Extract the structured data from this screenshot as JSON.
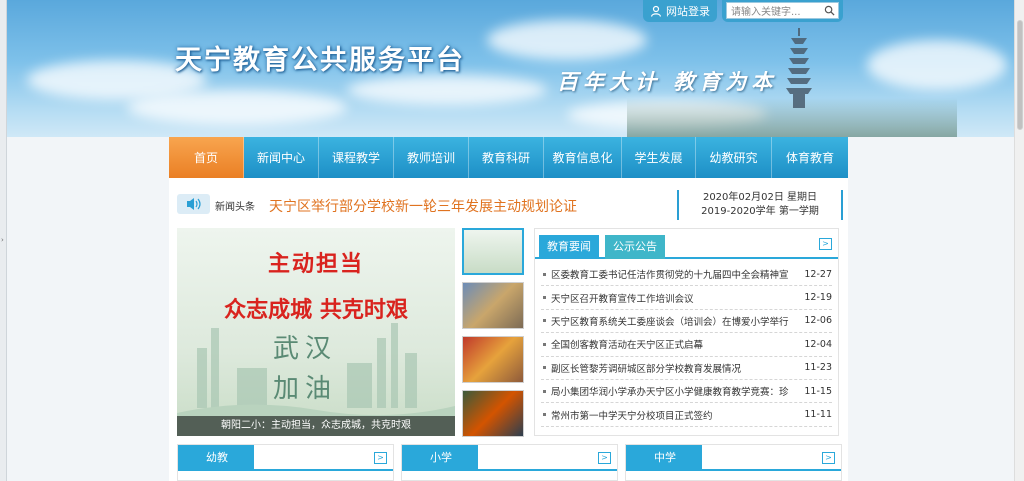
{
  "header": {
    "site_title": "天宁教育公共服务平台",
    "motto": "百年大计 教育为本",
    "login_label": "网站登录",
    "search_placeholder": "请输入关键字...",
    "colors": {
      "sky": "#6fb8e6",
      "accent": "#2aa8da"
    }
  },
  "nav": {
    "items": [
      {
        "label": "首页",
        "active": true
      },
      {
        "label": "新闻中心"
      },
      {
        "label": "课程教学"
      },
      {
        "label": "教师培训"
      },
      {
        "label": "教育科研"
      },
      {
        "label": "教育信息化"
      },
      {
        "label": "学生发展"
      },
      {
        "label": "幼教研究"
      },
      {
        "label": "体育教育"
      }
    ]
  },
  "headline": {
    "tag": "新闻头条",
    "text": "天宁区举行部分学校新一轮三年发展主动规划论证",
    "date_line": "2020年02月02日 星期日",
    "term_line": "2019-2020学年 第一学期"
  },
  "slideshow": {
    "line1": "主动担当",
    "line2": "众志成城 共克时艰",
    "line3": "武汉",
    "line4": "加油",
    "caption": "朝阳二小：主动担当，众志成城，共克时艰"
  },
  "news": {
    "tabs": [
      "教育要闻",
      "公示公告"
    ],
    "more_label": ">",
    "items": [
      {
        "title": "区委教育工委书记任洁作贯彻党的十九届四中全会精神宣",
        "date": "12-27"
      },
      {
        "title": "天宁区召开教育宣传工作培训会议",
        "date": "12-19"
      },
      {
        "title": "天宁区教育系统关工委座谈会（培训会）在博爱小学举行",
        "date": "12-06"
      },
      {
        "title": "全国创客教育活动在天宁区正式启幕",
        "date": "12-04"
      },
      {
        "title": "副区长管黎芳调研城区部分学校教育发展情况",
        "date": "11-23"
      },
      {
        "title": "局小集团华润小学承办天宁区小学健康教育教学竞赛：珍",
        "date": "11-15"
      },
      {
        "title": "常州市第一中学天宁分校项目正式签约",
        "date": "11-11"
      }
    ]
  },
  "categories": [
    {
      "label": "幼教",
      "more": ">"
    },
    {
      "label": "小学",
      "more": ">"
    },
    {
      "label": "中学",
      "more": ">"
    }
  ]
}
